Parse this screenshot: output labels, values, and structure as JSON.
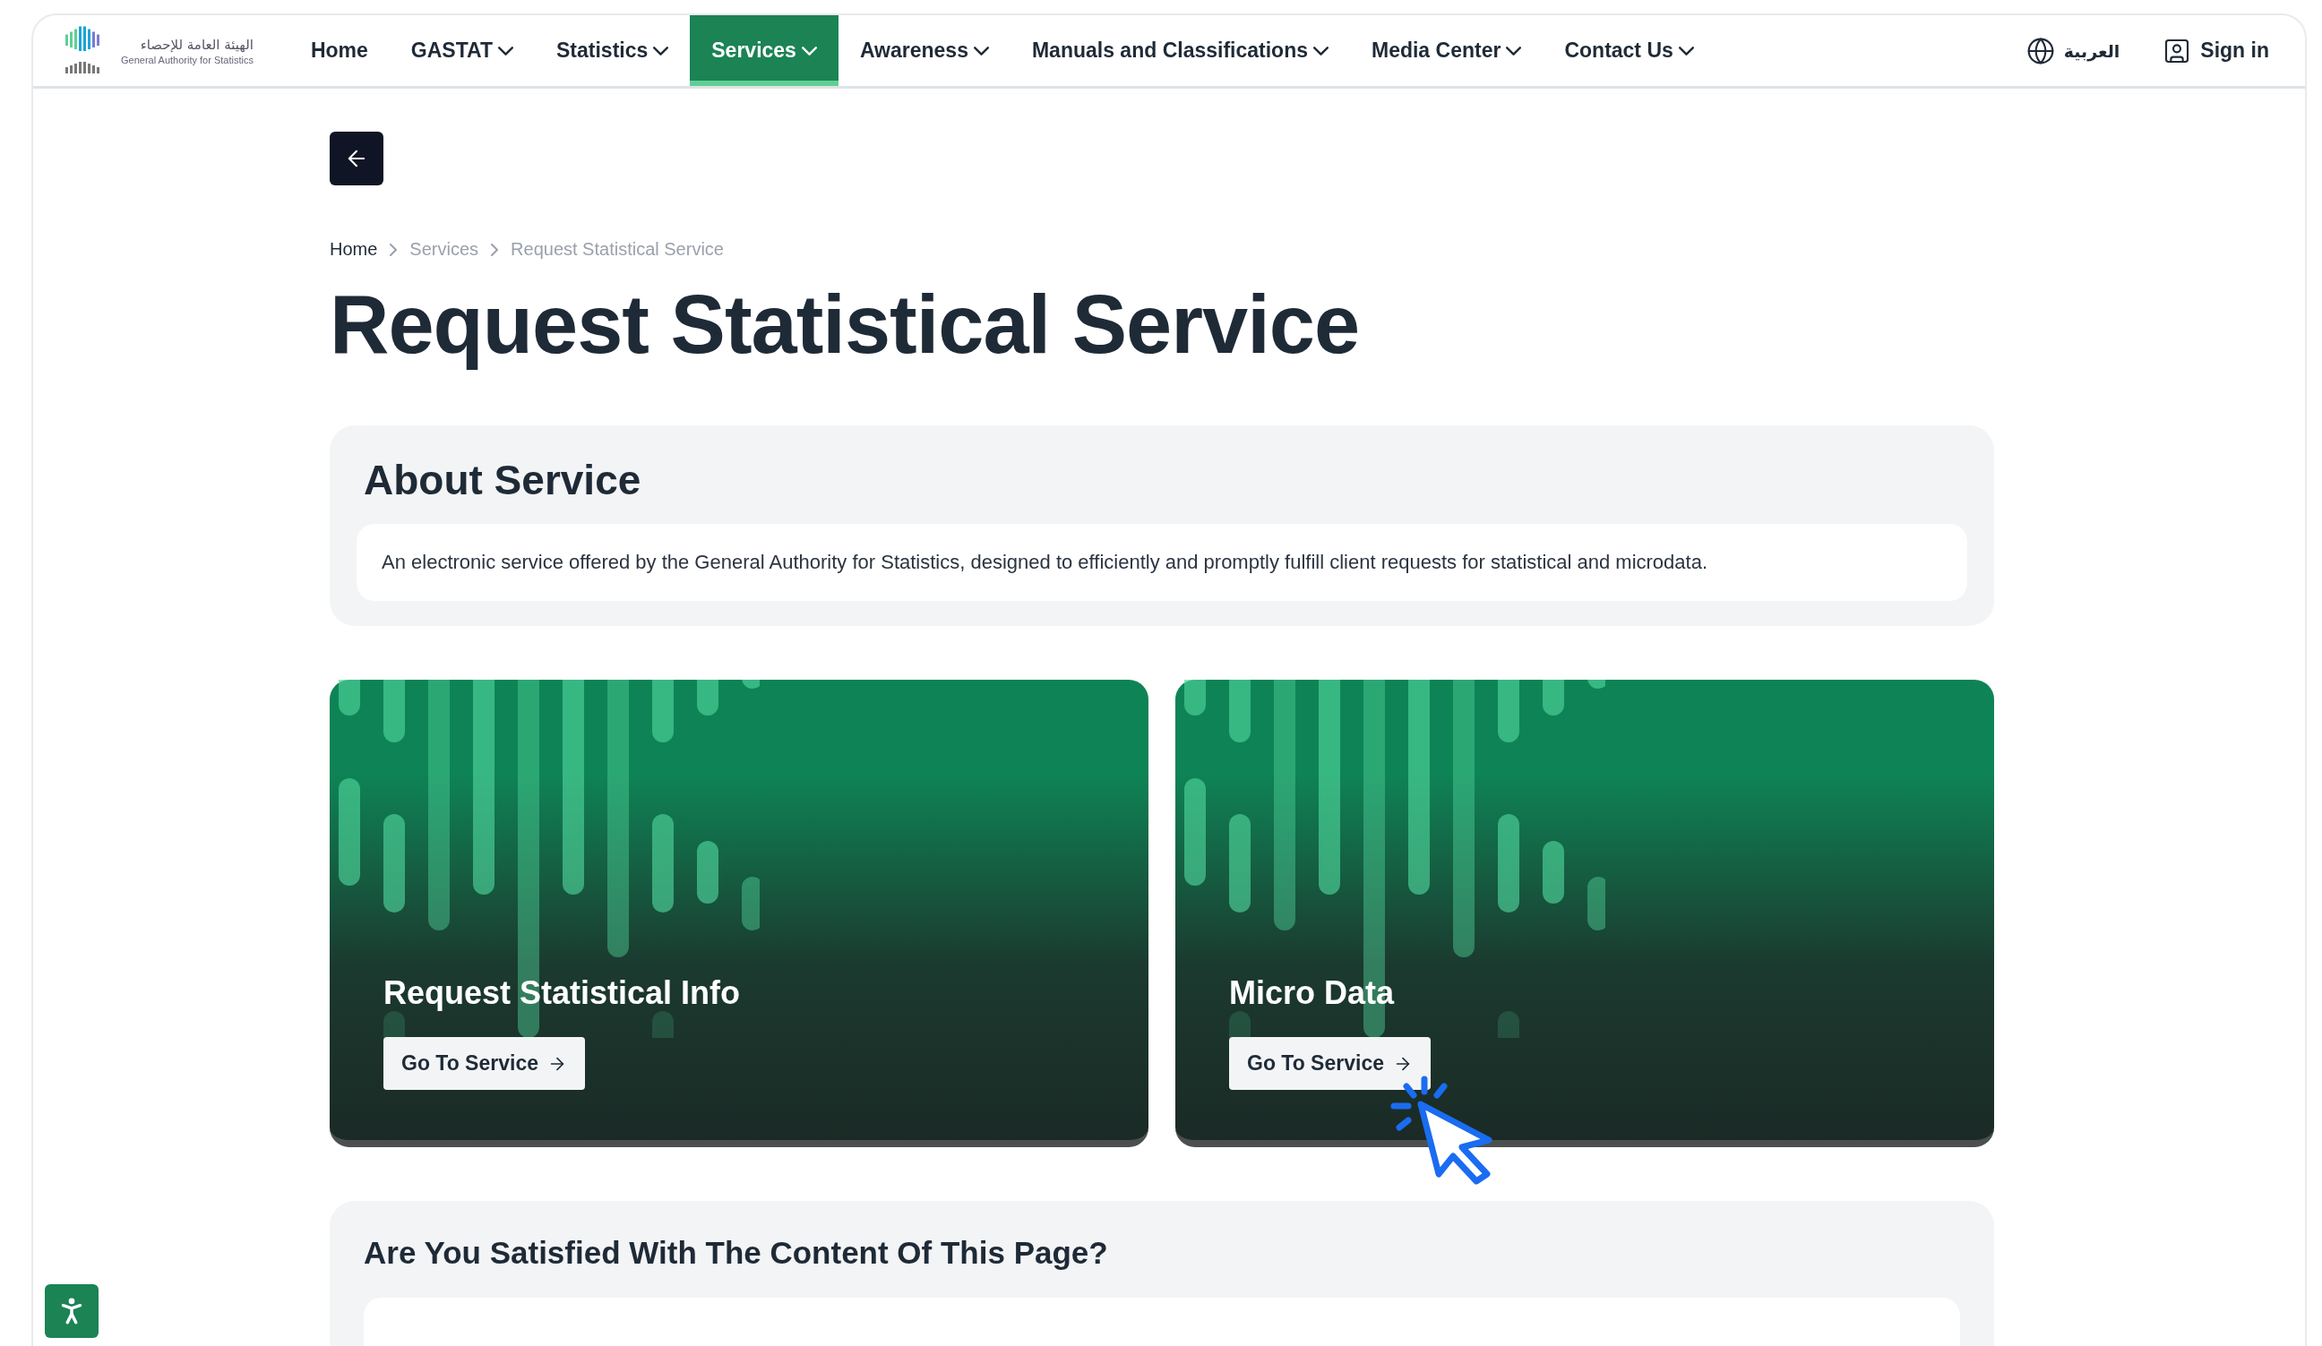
{
  "logo": {
    "arabic_name": "الهيئة العامة للإحصاء",
    "english_name": "General Authority for Statistics"
  },
  "nav": [
    {
      "label": "Home",
      "dropdown": false,
      "selected": false
    },
    {
      "label": "GASTAT",
      "dropdown": true,
      "selected": false
    },
    {
      "label": "Statistics",
      "dropdown": true,
      "selected": false
    },
    {
      "label": "Services",
      "dropdown": true,
      "selected": true
    },
    {
      "label": "Awareness",
      "dropdown": true,
      "selected": false
    },
    {
      "label": "Manuals and Classifications",
      "dropdown": true,
      "selected": false
    },
    {
      "label": "Media Center",
      "dropdown": true,
      "selected": false
    },
    {
      "label": "Contact Us",
      "dropdown": true,
      "selected": false
    }
  ],
  "language": "العربية",
  "sign_in": "Sign in",
  "breadcrumb": [
    "Home",
    "Services",
    "Request Statistical Service"
  ],
  "title": "Request Statistical Service",
  "about": {
    "heading": "About Service",
    "text": "An electronic service offered by the General Authority for Statistics, designed to efficiently and promptly fulfill client requests for statistical and microdata."
  },
  "services": [
    {
      "title": "Request Statistical Info",
      "button": "Go To Service",
      "cursor": false
    },
    {
      "title": "Micro Data",
      "button": "Go To Service",
      "cursor": true
    }
  ],
  "feedback": {
    "question": "Are You Satisfied With The Content Of This Page?"
  }
}
